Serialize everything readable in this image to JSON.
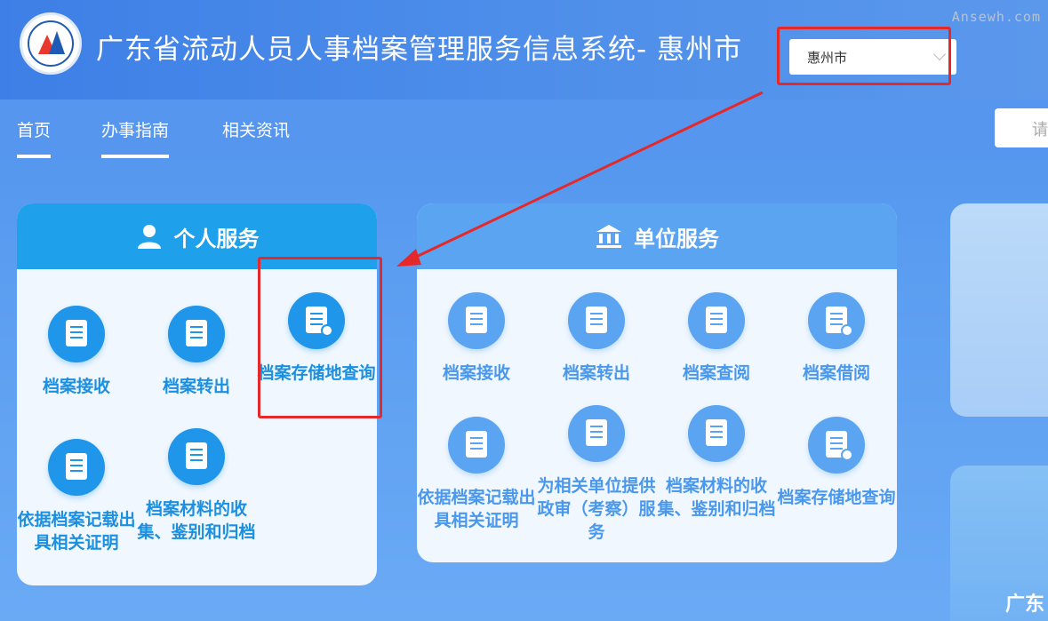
{
  "header": {
    "site_title": "广东省流动人员人事档案管理服务信息系统- 惠州市",
    "city_select_value": "惠州市",
    "watermark": "Ansewh.com"
  },
  "nav": {
    "items": [
      "首页",
      "办事指南",
      "相关资讯"
    ],
    "search_placeholder": "请"
  },
  "personal": {
    "title": "个人服务",
    "services": [
      {
        "label": "档案接收",
        "icon": "file-in-icon"
      },
      {
        "label": "档案转出",
        "icon": "file-out-icon"
      },
      {
        "label": "档案存储地查询",
        "icon": "file-search-icon"
      },
      {
        "label": "依据档案记载出具相关证明",
        "icon": "certificate-icon"
      },
      {
        "label": "档案材料的收集、鉴别和归档",
        "icon": "file-collect-icon"
      }
    ]
  },
  "unit": {
    "title": "单位服务",
    "services": [
      {
        "label": "档案接收",
        "icon": "file-in-icon"
      },
      {
        "label": "档案转出",
        "icon": "file-out-icon"
      },
      {
        "label": "档案查阅",
        "icon": "book-icon"
      },
      {
        "label": "档案借阅",
        "icon": "file-borrow-icon"
      },
      {
        "label": "依据档案记载出具相关证明",
        "icon": "certificate-icon"
      },
      {
        "label": "为相关单位提供政审（考察）服务",
        "icon": "review-icon"
      },
      {
        "label": "档案材料的收集、鉴别和归档",
        "icon": "file-collect-icon"
      },
      {
        "label": "档案存储地查询",
        "icon": "file-search-icon"
      }
    ]
  },
  "right_card_text": "广东",
  "colors": {
    "primary": "#1f96e9",
    "unit": "#5ba4f2",
    "annotation": "#e5282a"
  }
}
